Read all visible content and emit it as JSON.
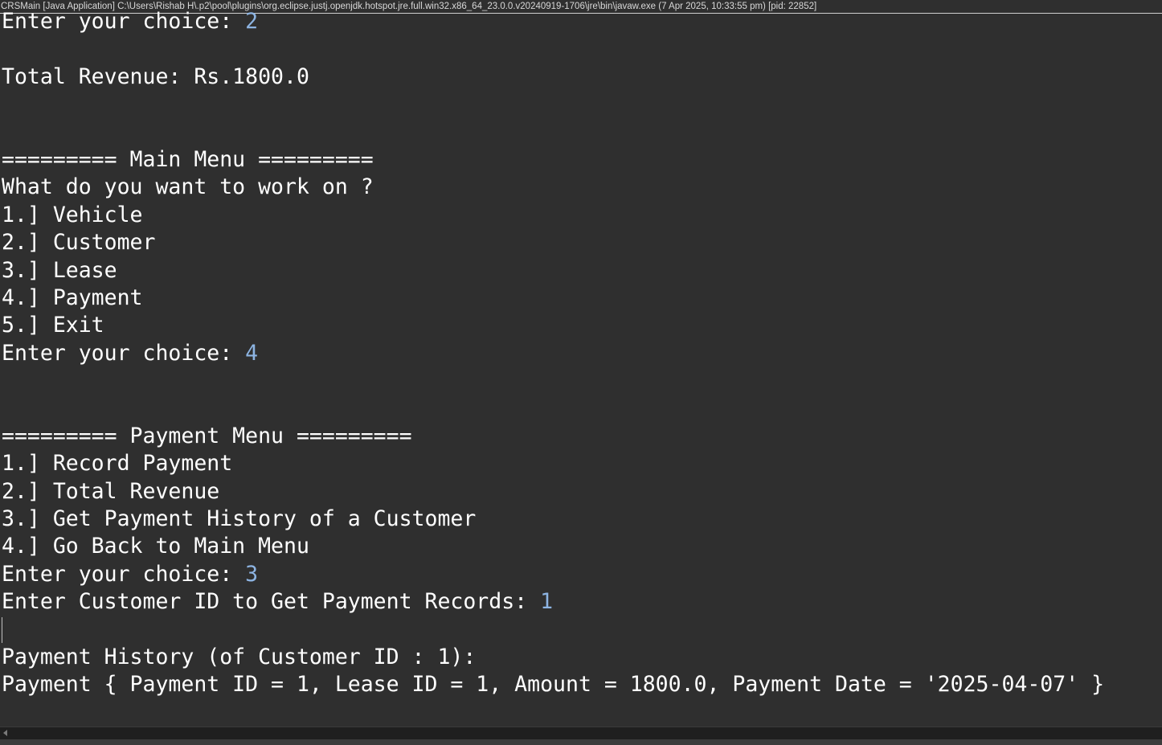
{
  "window": {
    "title": "CRSMain [Java Application] C:\\Users\\Rishab H\\.p2\\pool\\plugins\\org.eclipse.justj.openjdk.hotspot.jre.full.win32.x86_64_23.0.0.v20240919-1706\\jre\\bin\\javaw.exe  (7 Apr 2025, 10:33:55 pm) [pid: 22852]"
  },
  "console": {
    "lines": [
      {
        "text": "Enter your choice: ",
        "input": "2"
      },
      {
        "text": "",
        "input": ""
      },
      {
        "text": "Total Revenue: Rs.1800.0",
        "input": ""
      },
      {
        "text": "",
        "input": ""
      },
      {
        "text": "",
        "input": ""
      },
      {
        "text": "========= Main Menu =========",
        "input": ""
      },
      {
        "text": "What do you want to work on ?",
        "input": ""
      },
      {
        "text": "1.] Vehicle",
        "input": ""
      },
      {
        "text": "2.] Customer",
        "input": ""
      },
      {
        "text": "3.] Lease",
        "input": ""
      },
      {
        "text": "4.] Payment",
        "input": ""
      },
      {
        "text": "5.] Exit",
        "input": ""
      },
      {
        "text": "Enter your choice: ",
        "input": "4"
      },
      {
        "text": "",
        "input": ""
      },
      {
        "text": "",
        "input": ""
      },
      {
        "text": "========= Payment Menu =========",
        "input": ""
      },
      {
        "text": "1.] Record Payment",
        "input": ""
      },
      {
        "text": "2.] Total Revenue",
        "input": ""
      },
      {
        "text": "3.] Get Payment History of a Customer",
        "input": ""
      },
      {
        "text": "4.] Go Back to Main Menu",
        "input": ""
      },
      {
        "text": "Enter your choice: ",
        "input": "3"
      },
      {
        "text": "Enter Customer ID to Get Payment Records: ",
        "input": "1"
      },
      {
        "text": "",
        "input": ""
      },
      {
        "text": "Payment History (of Customer ID : 1):",
        "input": ""
      },
      {
        "text": "Payment { Payment ID = 1, Lease ID = 1, Amount = 1800.0, Payment Date = '2025-04-07' }",
        "input": ""
      }
    ]
  },
  "colors": {
    "background": "#2f2f2f",
    "output_text": "#ffffff",
    "user_input": "#8db4e2"
  }
}
